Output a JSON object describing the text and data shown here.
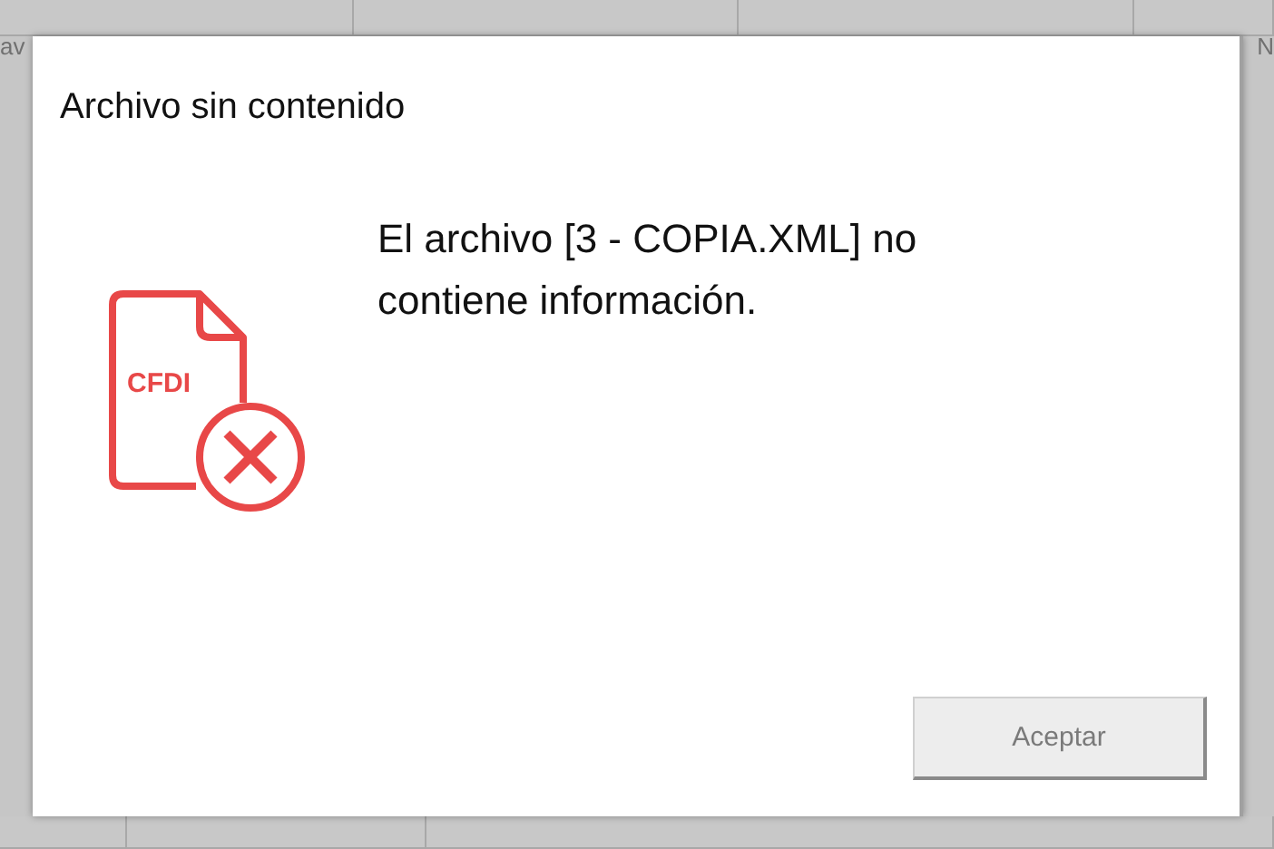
{
  "background": {
    "left_fragment": "av",
    "right_fragment": "N"
  },
  "dialog": {
    "title": "Archivo sin contenido",
    "icon_label": "CFDI",
    "message": "El archivo [3 - COPIA.XML] no contiene información.",
    "button": {
      "label": "Aceptar",
      "disabled": true
    }
  }
}
